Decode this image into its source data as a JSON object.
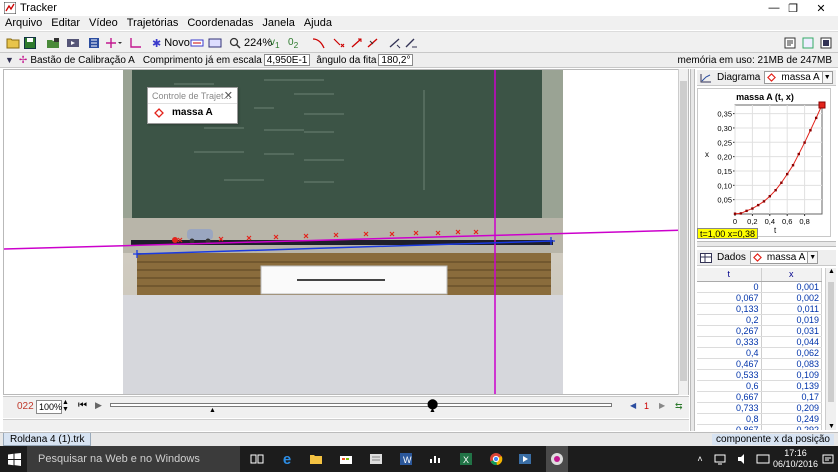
{
  "window": {
    "title": "Tracker",
    "minimize": "—",
    "maximize": "❐",
    "close": "✕"
  },
  "menu": [
    "Arquivo",
    "Editar",
    "Vídeo",
    "Trajetórias",
    "Coordenadas",
    "Janela",
    "Ajuda"
  ],
  "toolbar": {
    "novo_label": "Novo",
    "zoom_label": "224%",
    "new_icon": "star-icon"
  },
  "calibration": {
    "tool_label": "Bastão de Calibração A",
    "length_label": "Comprimento já em escala",
    "length_value": "4,950E-1",
    "angle_label": "ângulo da fita",
    "angle_value": "180,2°",
    "memory": "memória em uso: 21MB de 247MB"
  },
  "track_control": {
    "title": "Controle de Trajet...",
    "track_name": "massa A"
  },
  "player": {
    "frame": "022",
    "zoom": "100%",
    "step": "1"
  },
  "plot_panel": {
    "tab_label": "Diagrama",
    "track": "massa A",
    "chart_data": {
      "type": "scatter",
      "title": "massa A (t, x)",
      "xlabel": "t",
      "ylabel": "x",
      "xlim": [
        0,
        1.0
      ],
      "ylim": [
        0,
        0.38
      ],
      "x_ticks": [
        "0",
        "0,2",
        "0,4",
        "0,6",
        "0,8"
      ],
      "y_ticks": [
        "0,05",
        "0,10",
        "0,15",
        "0,20",
        "0,25",
        "0,30",
        "0,35"
      ],
      "x": [
        0,
        0.067,
        0.133,
        0.2,
        0.267,
        0.333,
        0.4,
        0.467,
        0.533,
        0.6,
        0.667,
        0.733,
        0.8,
        0.867,
        0.933,
        1.0
      ],
      "y": [
        0.001,
        0.002,
        0.011,
        0.019,
        0.031,
        0.044,
        0.062,
        0.083,
        0.109,
        0.139,
        0.17,
        0.209,
        0.249,
        0.292,
        0.335,
        0.38
      ]
    },
    "readout": "t=1,00  x=0,38"
  },
  "table_panel": {
    "tab_label": "Dados",
    "track": "massa A",
    "columns": [
      "t",
      "x"
    ],
    "rows": [
      [
        "0",
        "0,001"
      ],
      [
        "0,067",
        "0,002"
      ],
      [
        "0,133",
        "0,011"
      ],
      [
        "0,2",
        "0,019"
      ],
      [
        "0,267",
        "0,031"
      ],
      [
        "0,333",
        "0,044"
      ],
      [
        "0,4",
        "0,062"
      ],
      [
        "0,467",
        "0,083"
      ],
      [
        "0,533",
        "0,109"
      ],
      [
        "0,6",
        "0,139"
      ],
      [
        "0,667",
        "0,17"
      ],
      [
        "0,733",
        "0,209"
      ],
      [
        "0,8",
        "0,249"
      ],
      [
        "0,867",
        "0,292"
      ],
      [
        "0,933",
        "0,335"
      ]
    ]
  },
  "status": {
    "file_tab": "Roldana 4 (1).trk",
    "right": "componente x da posição"
  },
  "taskbar": {
    "search_placeholder": "Pesquisar na Web e no Windows",
    "time": "17:16",
    "date": "06/10/2016"
  },
  "colors": {
    "accent_magenta": "#cc00cc",
    "track_red": "#e3231b",
    "table_blue": "#0033aa"
  }
}
